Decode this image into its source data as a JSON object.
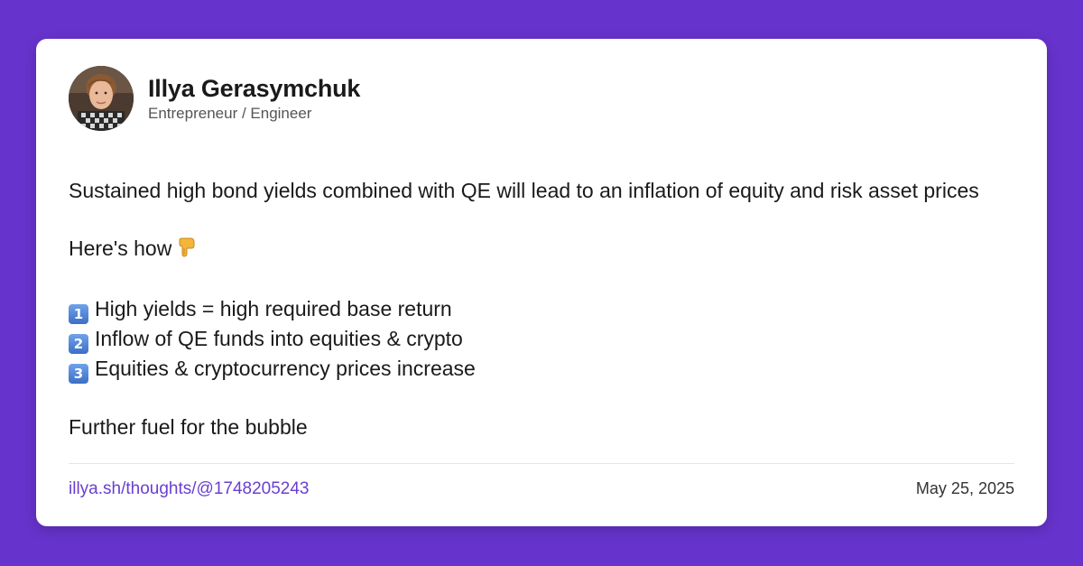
{
  "author": {
    "name": "Illya Gerasymchuk",
    "title": "Entrepreneur / Engineer",
    "avatar_icon": "avatar-photo"
  },
  "post": {
    "paragraph_1": "Sustained high bond yields combined with QE will lead to an inflation of equity and risk asset prices",
    "paragraph_2": "Here's how",
    "paragraph_2_emoji": "pointing-down-icon",
    "list": [
      {
        "marker": "1",
        "text": "High yields = high required base return"
      },
      {
        "marker": "2",
        "text": "Inflow of QE funds into equities & crypto"
      },
      {
        "marker": "3",
        "text": "Equities & cryptocurrency prices increase"
      }
    ],
    "paragraph_3": "Further fuel for the bubble"
  },
  "footer": {
    "link_text": "illya.sh/thoughts/@1748205243",
    "date": "May 25, 2025"
  },
  "colors": {
    "background": "#6633cc",
    "link": "#6a3fd1",
    "keycap": "#4a7fd6"
  }
}
